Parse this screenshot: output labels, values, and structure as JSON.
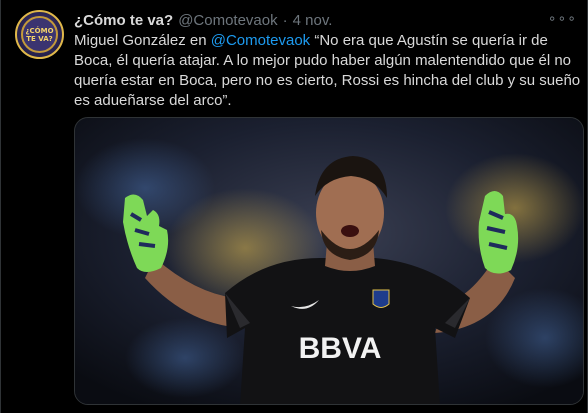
{
  "tweet": {
    "display_name": "¿Cómo te va?",
    "handle": "@Comotevaok",
    "separator": "·",
    "date": "4 nov.",
    "more_label": "∘∘∘",
    "text_prefix": "Miguel González en ",
    "text_mention": "@Comotevaok",
    "text_body": " “No era que Agustín se quería ir de Boca, él quería atajar. A lo mejor pudo haber algún malentendido que él no quería estar en Boca, pero no es cierto, Rossi es hincha del club y su sueño es adueñarse del arco”."
  },
  "avatar": {
    "logo_line1": "¿CÓMO",
    "logo_line2": "TE VA?"
  },
  "media": {
    "jersey_sponsor": "BBVA"
  },
  "colors": {
    "background": "#000000",
    "text": "#d9d9d9",
    "muted": "#6e767d",
    "link": "#1d9bf0",
    "glove_green": "#7ed957"
  }
}
